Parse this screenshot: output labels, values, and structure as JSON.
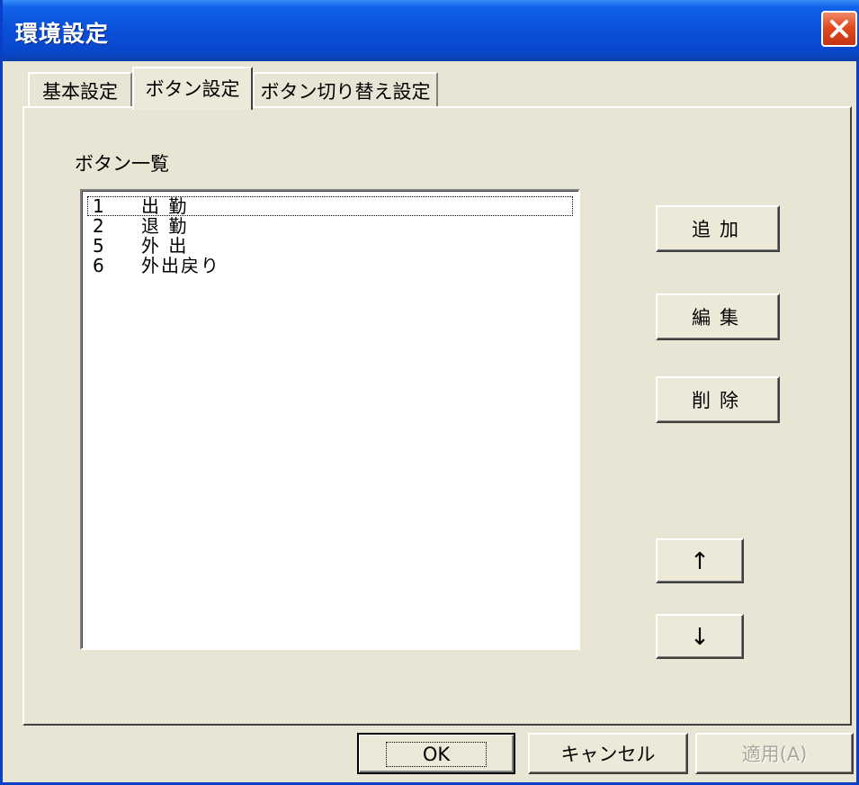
{
  "window": {
    "title": "環境設定"
  },
  "tabs": [
    {
      "label": "基本設定"
    },
    {
      "label": "ボタン設定"
    },
    {
      "label": "ボタン切り替え設定"
    }
  ],
  "list": {
    "label": "ボタン一覧",
    "items": [
      {
        "num": "1",
        "name": "出 勤"
      },
      {
        "num": "2",
        "name": "退 勤"
      },
      {
        "num": "5",
        "name": "外 出"
      },
      {
        "num": "6",
        "name": "外出戻り"
      }
    ],
    "focused_index": 0
  },
  "side_buttons": {
    "add": "追加",
    "edit": "編集",
    "delete": "削除",
    "up": "↑",
    "down": "↓"
  },
  "dialog_buttons": {
    "ok": "OK",
    "cancel": "キャンセル",
    "apply": "適用(A)"
  },
  "colors": {
    "titlebar": "#0a4fd8",
    "face": "#ece9d8",
    "close": "#e04a1e"
  }
}
